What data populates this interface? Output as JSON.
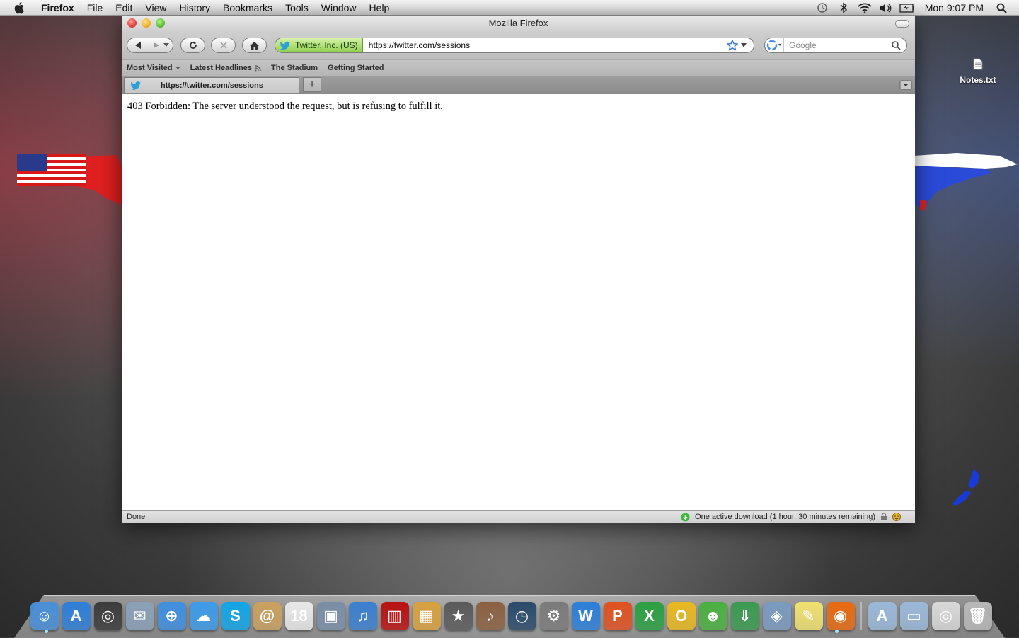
{
  "menubar": {
    "app_name": "Firefox",
    "items": [
      "File",
      "Edit",
      "View",
      "History",
      "Bookmarks",
      "Tools",
      "Window",
      "Help"
    ],
    "clock": "Mon 9:07 PM"
  },
  "desktop": {
    "file_label": "Notes.txt"
  },
  "window": {
    "title": "Mozilla Firefox",
    "identity_label": "Twitter, Inc. (US)",
    "url": "https://twitter.com/sessions",
    "search_placeholder": "Google",
    "bookmarks": [
      "Most Visited",
      "Latest Headlines",
      "The Stadium",
      "Getting Started"
    ],
    "tab_title": "https://twitter.com/sessions",
    "newtab_symbol": "+",
    "page_text": "403 Forbidden: The server understood the request, but is refusing to fulfill it.",
    "status_left": "Done",
    "status_right": "One active download (1 hour, 30 minutes remaining)"
  },
  "dock": {
    "icons": [
      {
        "name": "finder",
        "color": "#4a8fd8",
        "glyph": "☺"
      },
      {
        "name": "app-store",
        "color": "#2f7fd8",
        "glyph": "A"
      },
      {
        "name": "dashboard",
        "color": "#3b3b3b",
        "glyph": "◎"
      },
      {
        "name": "mail",
        "color": "#8aa0b8",
        "glyph": "✉"
      },
      {
        "name": "safari",
        "color": "#3f8fe0",
        "glyph": "⊕"
      },
      {
        "name": "ichat",
        "color": "#3d9be9",
        "glyph": "☁"
      },
      {
        "name": "skype",
        "color": "#12a5e6",
        "glyph": "S"
      },
      {
        "name": "address-book",
        "color": "#c9a060",
        "glyph": "@"
      },
      {
        "name": "ical",
        "color": "#e8e8e8",
        "glyph": "18"
      },
      {
        "name": "preview",
        "color": "#7a8ea8",
        "glyph": "▣"
      },
      {
        "name": "itunes",
        "color": "#3a7fd0",
        "glyph": "♫"
      },
      {
        "name": "photo-booth",
        "color": "#b81010",
        "glyph": "▥"
      },
      {
        "name": "iphoto",
        "color": "#d8a040",
        "glyph": "▦"
      },
      {
        "name": "imovie",
        "color": "#5a5a5a",
        "glyph": "★"
      },
      {
        "name": "garageband",
        "color": "#8a6040",
        "glyph": "♪"
      },
      {
        "name": "time-machine",
        "color": "#2a4a6a",
        "glyph": "◷"
      },
      {
        "name": "system-preferences",
        "color": "#7a7a7a",
        "glyph": "⚙"
      },
      {
        "name": "word",
        "color": "#2a7fd8",
        "glyph": "W"
      },
      {
        "name": "powerpoint",
        "color": "#e05020",
        "glyph": "P"
      },
      {
        "name": "excel",
        "color": "#2aa040",
        "glyph": "X"
      },
      {
        "name": "outlook",
        "color": "#e8b820",
        "glyph": "O"
      },
      {
        "name": "messenger",
        "color": "#4ab040",
        "glyph": "☻"
      },
      {
        "name": "downloads-globe",
        "color": "#3a9a50",
        "glyph": "⇓"
      },
      {
        "name": "remote-desktop",
        "color": "#7a9ac0",
        "glyph": "◈"
      },
      {
        "name": "stickies",
        "color": "#f0e070",
        "glyph": "✎"
      },
      {
        "name": "firefox",
        "color": "#e86a10",
        "glyph": "◉"
      }
    ],
    "right_icons": [
      {
        "name": "applications-folder",
        "color": "#9ab8d8",
        "glyph": "A"
      },
      {
        "name": "documents-folder",
        "color": "#9ab8d8",
        "glyph": "▭"
      },
      {
        "name": "movie-file",
        "color": "#d8d8d8",
        "glyph": "◎"
      },
      {
        "name": "trash",
        "color": "#b8b8b8",
        "glyph": "🗑"
      }
    ]
  },
  "colors": {
    "identity_green": "#8fcf4e",
    "accent_blue": "#3a7fd0"
  }
}
